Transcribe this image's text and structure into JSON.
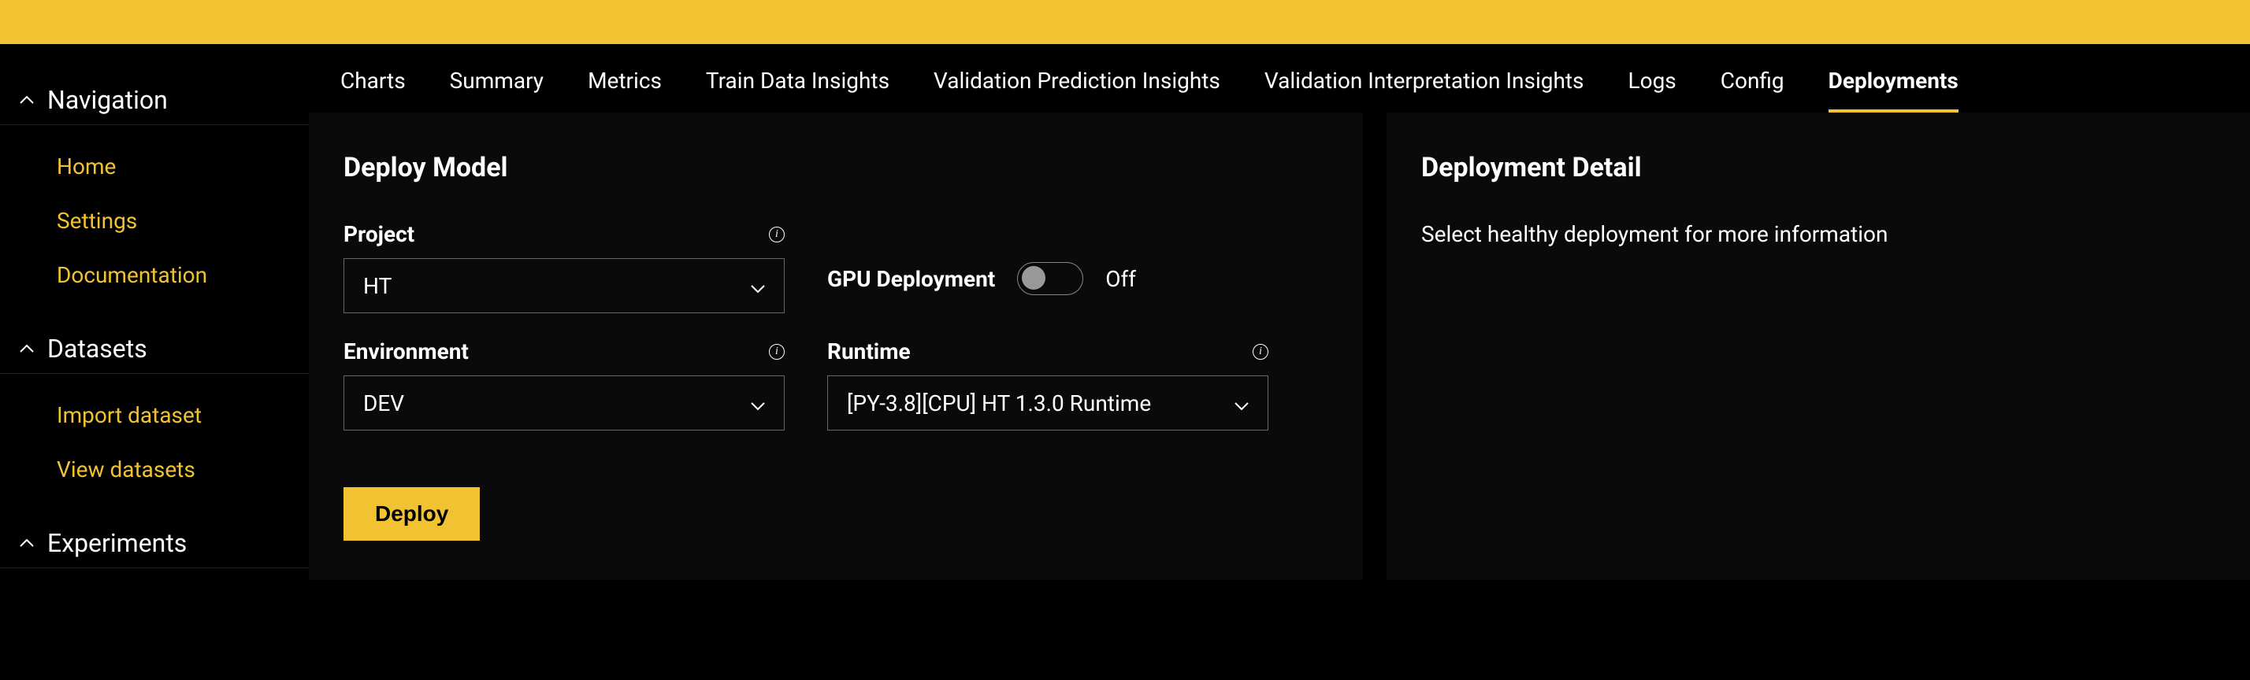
{
  "sidebar": {
    "sections": [
      {
        "title": "Navigation",
        "items": [
          "Home",
          "Settings",
          "Documentation"
        ]
      },
      {
        "title": "Datasets",
        "items": [
          "Import dataset",
          "View datasets"
        ]
      },
      {
        "title": "Experiments",
        "items": []
      }
    ]
  },
  "tabs": [
    "Charts",
    "Summary",
    "Metrics",
    "Train Data Insights",
    "Validation Prediction Insights",
    "Validation Interpretation Insights",
    "Logs",
    "Config",
    "Deployments"
  ],
  "active_tab": "Deployments",
  "deploy_panel": {
    "title": "Deploy Model",
    "project": {
      "label": "Project",
      "value": "HT"
    },
    "gpu": {
      "label": "GPU Deployment",
      "state": "Off"
    },
    "environment": {
      "label": "Environment",
      "value": "DEV"
    },
    "runtime": {
      "label": "Runtime",
      "value": "[PY-3.8][CPU] HT 1.3.0 Runtime"
    },
    "deploy_button": "Deploy"
  },
  "detail_panel": {
    "title": "Deployment Detail",
    "text": "Select healthy deployment for more information"
  }
}
